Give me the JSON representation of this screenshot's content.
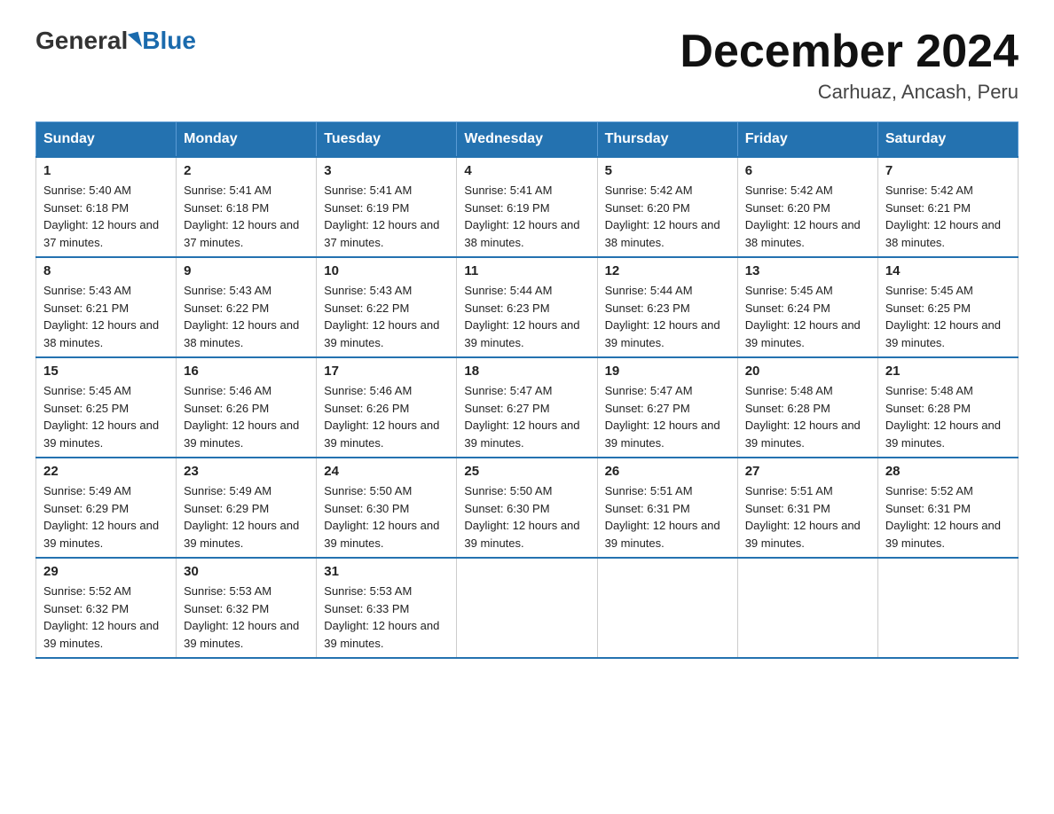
{
  "header": {
    "logo_general": "General",
    "logo_blue": "Blue",
    "month_title": "December 2024",
    "location": "Carhuaz, Ancash, Peru"
  },
  "weekdays": [
    "Sunday",
    "Monday",
    "Tuesday",
    "Wednesday",
    "Thursday",
    "Friday",
    "Saturday"
  ],
  "weeks": [
    [
      {
        "day": "1",
        "sunrise": "5:40 AM",
        "sunset": "6:18 PM",
        "daylight": "12 hours and 37 minutes."
      },
      {
        "day": "2",
        "sunrise": "5:41 AM",
        "sunset": "6:18 PM",
        "daylight": "12 hours and 37 minutes."
      },
      {
        "day": "3",
        "sunrise": "5:41 AM",
        "sunset": "6:19 PM",
        "daylight": "12 hours and 37 minutes."
      },
      {
        "day": "4",
        "sunrise": "5:41 AM",
        "sunset": "6:19 PM",
        "daylight": "12 hours and 38 minutes."
      },
      {
        "day": "5",
        "sunrise": "5:42 AM",
        "sunset": "6:20 PM",
        "daylight": "12 hours and 38 minutes."
      },
      {
        "day": "6",
        "sunrise": "5:42 AM",
        "sunset": "6:20 PM",
        "daylight": "12 hours and 38 minutes."
      },
      {
        "day": "7",
        "sunrise": "5:42 AM",
        "sunset": "6:21 PM",
        "daylight": "12 hours and 38 minutes."
      }
    ],
    [
      {
        "day": "8",
        "sunrise": "5:43 AM",
        "sunset": "6:21 PM",
        "daylight": "12 hours and 38 minutes."
      },
      {
        "day": "9",
        "sunrise": "5:43 AM",
        "sunset": "6:22 PM",
        "daylight": "12 hours and 38 minutes."
      },
      {
        "day": "10",
        "sunrise": "5:43 AM",
        "sunset": "6:22 PM",
        "daylight": "12 hours and 39 minutes."
      },
      {
        "day": "11",
        "sunrise": "5:44 AM",
        "sunset": "6:23 PM",
        "daylight": "12 hours and 39 minutes."
      },
      {
        "day": "12",
        "sunrise": "5:44 AM",
        "sunset": "6:23 PM",
        "daylight": "12 hours and 39 minutes."
      },
      {
        "day": "13",
        "sunrise": "5:45 AM",
        "sunset": "6:24 PM",
        "daylight": "12 hours and 39 minutes."
      },
      {
        "day": "14",
        "sunrise": "5:45 AM",
        "sunset": "6:25 PM",
        "daylight": "12 hours and 39 minutes."
      }
    ],
    [
      {
        "day": "15",
        "sunrise": "5:45 AM",
        "sunset": "6:25 PM",
        "daylight": "12 hours and 39 minutes."
      },
      {
        "day": "16",
        "sunrise": "5:46 AM",
        "sunset": "6:26 PM",
        "daylight": "12 hours and 39 minutes."
      },
      {
        "day": "17",
        "sunrise": "5:46 AM",
        "sunset": "6:26 PM",
        "daylight": "12 hours and 39 minutes."
      },
      {
        "day": "18",
        "sunrise": "5:47 AM",
        "sunset": "6:27 PM",
        "daylight": "12 hours and 39 minutes."
      },
      {
        "day": "19",
        "sunrise": "5:47 AM",
        "sunset": "6:27 PM",
        "daylight": "12 hours and 39 minutes."
      },
      {
        "day": "20",
        "sunrise": "5:48 AM",
        "sunset": "6:28 PM",
        "daylight": "12 hours and 39 minutes."
      },
      {
        "day": "21",
        "sunrise": "5:48 AM",
        "sunset": "6:28 PM",
        "daylight": "12 hours and 39 minutes."
      }
    ],
    [
      {
        "day": "22",
        "sunrise": "5:49 AM",
        "sunset": "6:29 PM",
        "daylight": "12 hours and 39 minutes."
      },
      {
        "day": "23",
        "sunrise": "5:49 AM",
        "sunset": "6:29 PM",
        "daylight": "12 hours and 39 minutes."
      },
      {
        "day": "24",
        "sunrise": "5:50 AM",
        "sunset": "6:30 PM",
        "daylight": "12 hours and 39 minutes."
      },
      {
        "day": "25",
        "sunrise": "5:50 AM",
        "sunset": "6:30 PM",
        "daylight": "12 hours and 39 minutes."
      },
      {
        "day": "26",
        "sunrise": "5:51 AM",
        "sunset": "6:31 PM",
        "daylight": "12 hours and 39 minutes."
      },
      {
        "day": "27",
        "sunrise": "5:51 AM",
        "sunset": "6:31 PM",
        "daylight": "12 hours and 39 minutes."
      },
      {
        "day": "28",
        "sunrise": "5:52 AM",
        "sunset": "6:31 PM",
        "daylight": "12 hours and 39 minutes."
      }
    ],
    [
      {
        "day": "29",
        "sunrise": "5:52 AM",
        "sunset": "6:32 PM",
        "daylight": "12 hours and 39 minutes."
      },
      {
        "day": "30",
        "sunrise": "5:53 AM",
        "sunset": "6:32 PM",
        "daylight": "12 hours and 39 minutes."
      },
      {
        "day": "31",
        "sunrise": "5:53 AM",
        "sunset": "6:33 PM",
        "daylight": "12 hours and 39 minutes."
      },
      null,
      null,
      null,
      null
    ]
  ]
}
